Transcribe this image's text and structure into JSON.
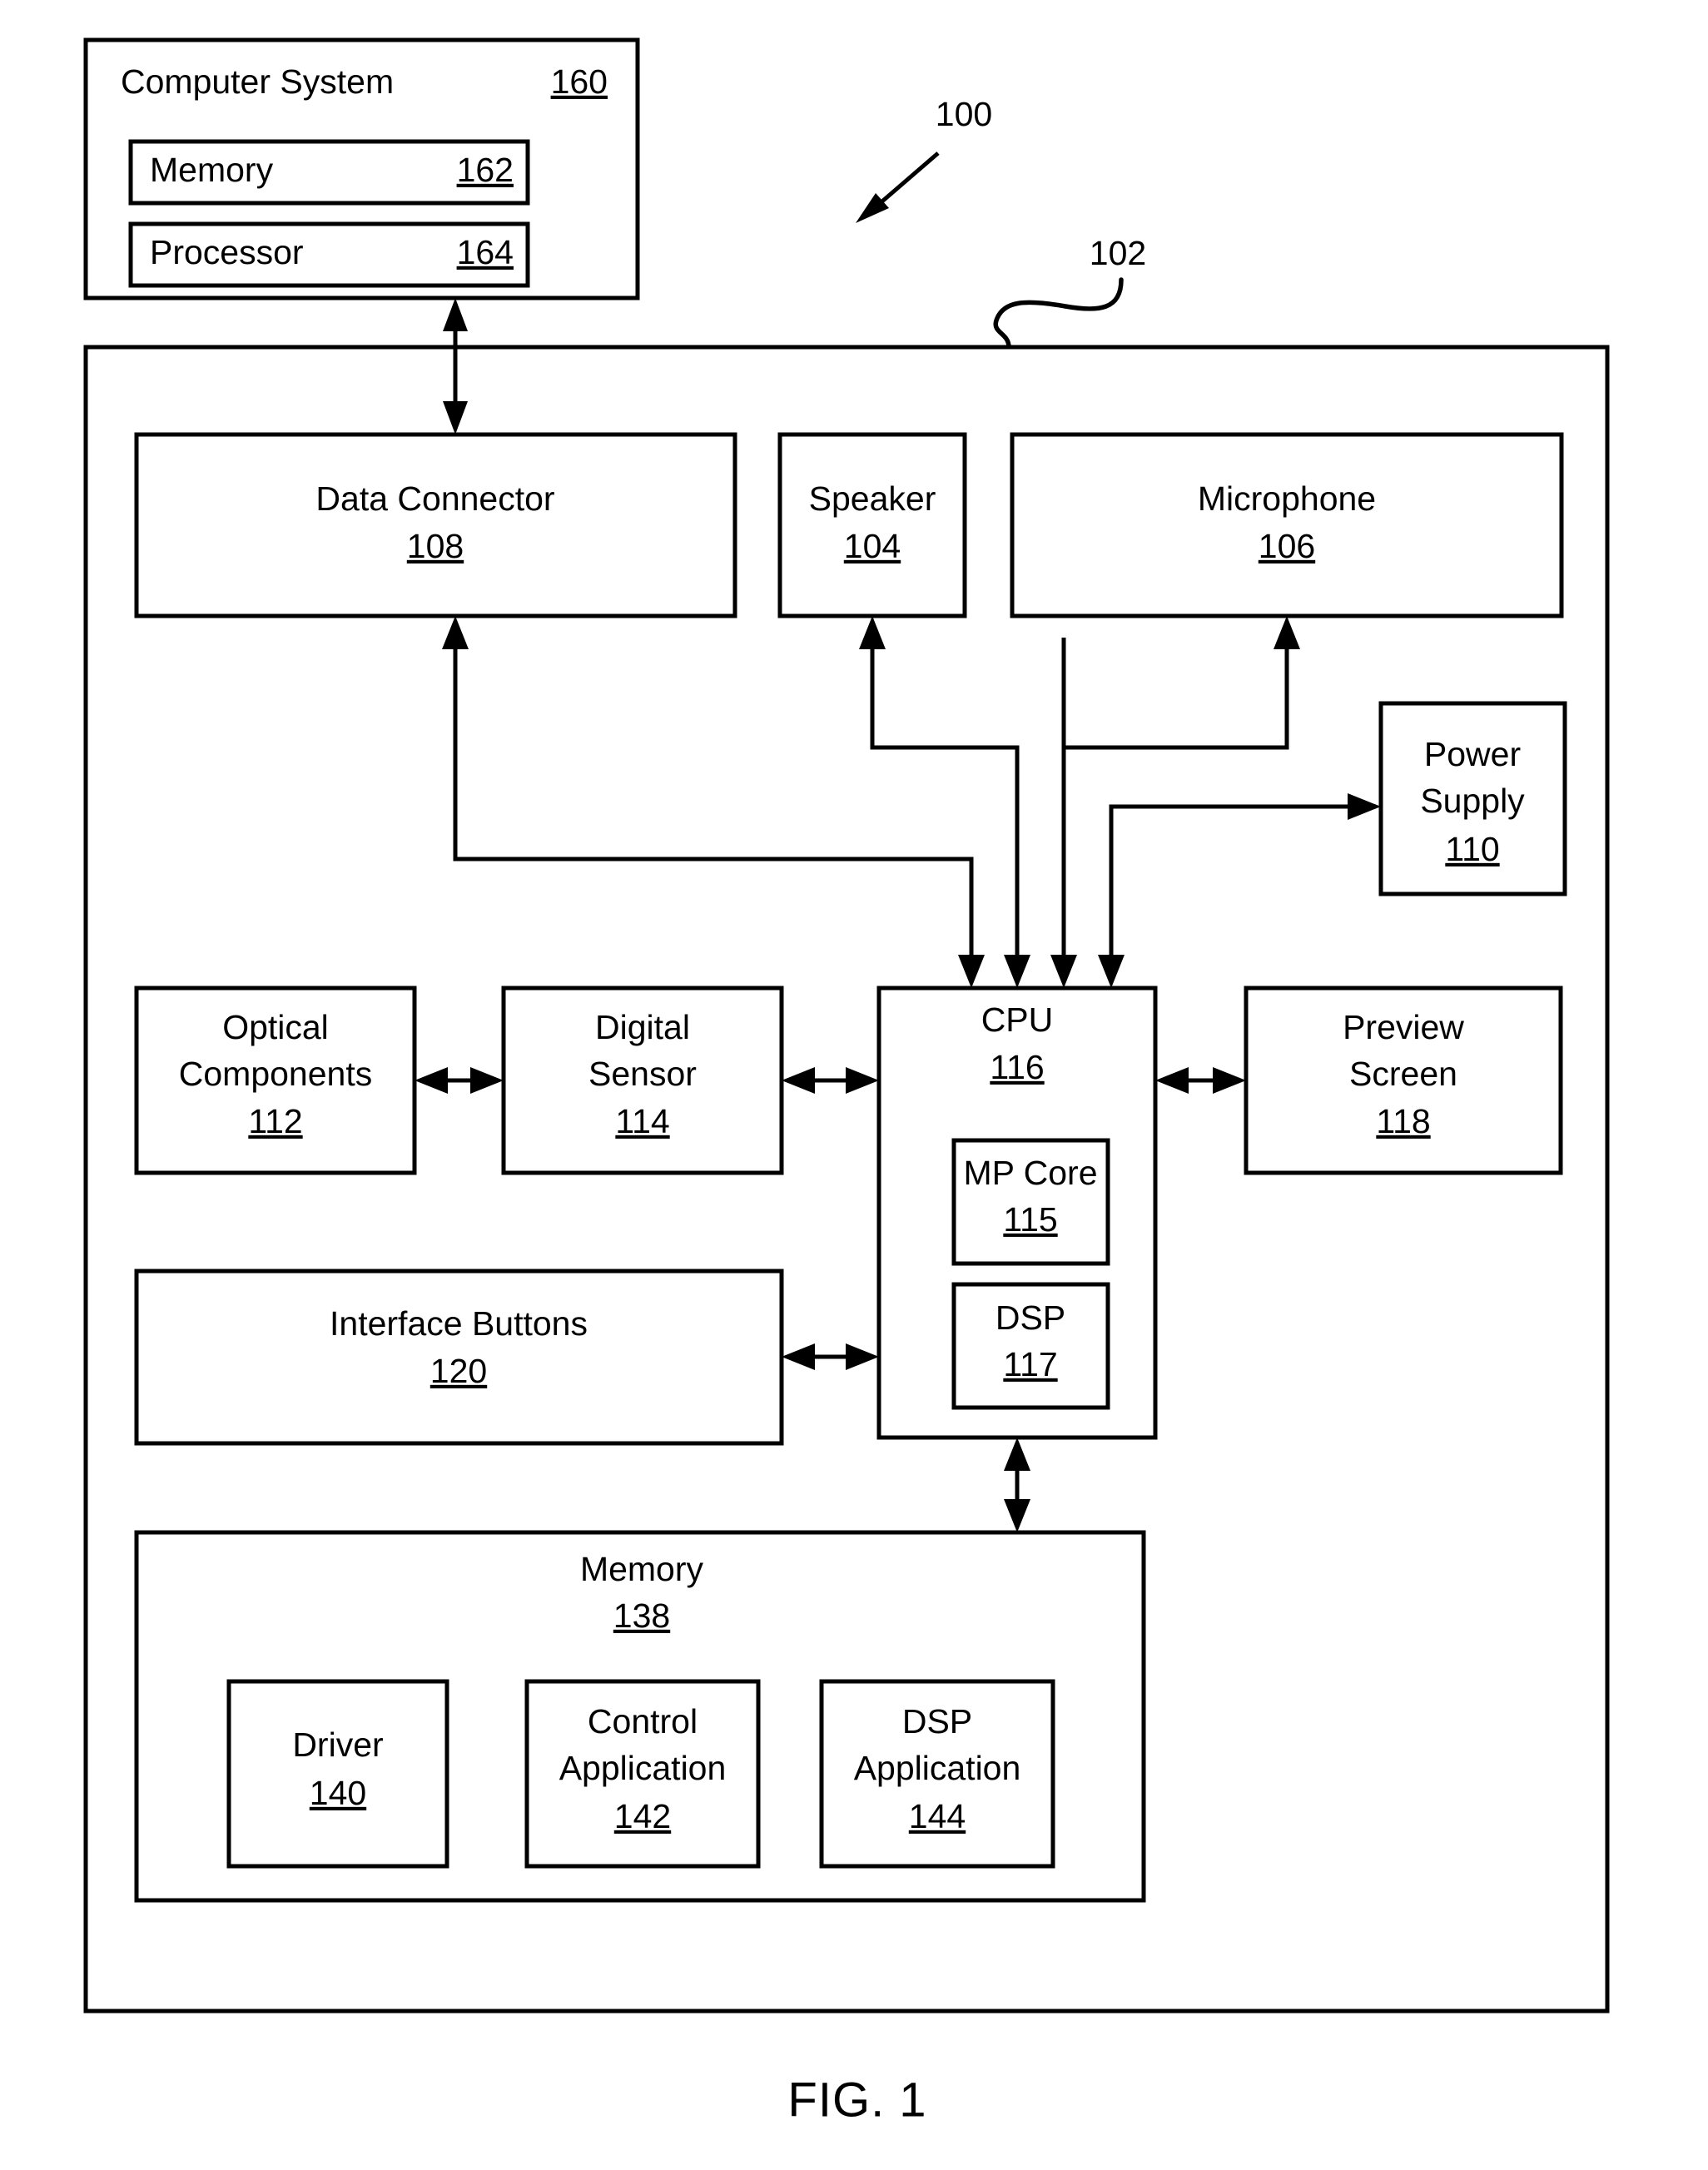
{
  "figure": {
    "caption": "FIG. 1",
    "callouts": [
      {
        "id": "callout-100",
        "text": "100"
      },
      {
        "id": "callout-102",
        "text": "102"
      }
    ]
  },
  "computer_system": {
    "title": "Computer System",
    "ref": "160",
    "children": [
      {
        "title": "Memory",
        "ref": "162"
      },
      {
        "title": "Processor",
        "ref": "164"
      }
    ]
  },
  "device": {
    "ref": "102",
    "blocks": {
      "data_connector": {
        "title": "Data Connector",
        "ref": "108"
      },
      "speaker": {
        "title": "Speaker",
        "ref": "104"
      },
      "microphone": {
        "title": "Microphone",
        "ref": "106"
      },
      "power_supply": {
        "title_line1": "Power",
        "title_line2": "Supply",
        "ref": "110"
      },
      "optical_components": {
        "title_line1": "Optical",
        "title_line2": "Components",
        "ref": "112"
      },
      "digital_sensor": {
        "title_line1": "Digital",
        "title_line2": "Sensor",
        "ref": "114"
      },
      "cpu": {
        "title": "CPU",
        "ref": "116",
        "children": [
          {
            "title": "MP Core",
            "ref": "115"
          },
          {
            "title": "DSP",
            "ref": "117"
          }
        ]
      },
      "preview_screen": {
        "title_line1": "Preview",
        "title_line2": "Screen",
        "ref": "118"
      },
      "interface_buttons": {
        "title": "Interface Buttons",
        "ref": "120"
      },
      "memory": {
        "title": "Memory",
        "ref": "138",
        "children": [
          {
            "title": "Driver",
            "ref": "140"
          },
          {
            "title_line1": "Control",
            "title_line2": "Application",
            "ref": "142"
          },
          {
            "title_line1": "DSP",
            "title_line2": "Application",
            "ref": "144"
          }
        ]
      }
    }
  },
  "colors": {
    "ink": "#000000",
    "paper": "#ffffff"
  }
}
